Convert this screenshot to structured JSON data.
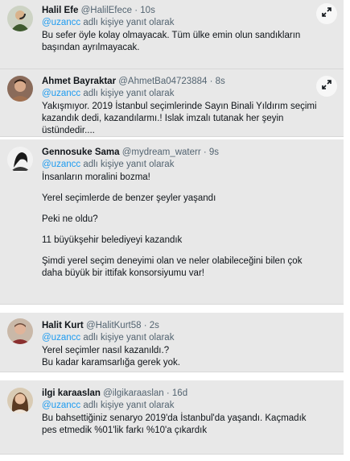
{
  "tweets": [
    {
      "name": "Halil Efe",
      "handle": "@HalilEfece",
      "time": "· 10s",
      "reply_mention": "@uzancc",
      "reply_suffix": " adlı kişiye yanıt olarak",
      "paragraphs": [
        "Bu sefer öyle kolay olmayacak. Tüm ülke emin olun sandıkların başından ayrılmayacak."
      ],
      "avatar_icon": "profile-photo",
      "expand_icon": "expand-arrows-icon"
    },
    {
      "name": "Ahmet Bayraktar",
      "handle": "@AhmetBa04723884",
      "time": "· 8s",
      "reply_mention": "@uzancc",
      "reply_suffix": " adlı kişiye yanıt olarak",
      "paragraphs": [
        "Yakışmıyor. 2019 İstanbul seçimlerinde Sayın Binali Yıldırım seçimi kazandık dedi, kazandılarmı.! Islak imzalı tutanak her şeyin üstündedir...."
      ],
      "avatar_icon": "profile-photo",
      "expand_icon": "expand-arrows-icon"
    },
    {
      "name": "Gennosuke Sama",
      "handle": "@mydream_waterr",
      "time": "· 9s",
      "reply_mention": "@uzancc",
      "reply_suffix": " adlı kişiye yanıt olarak",
      "paragraphs": [
        "İnsanların moralini bozma!",
        "Yerel seçimlerde de benzer şeyler yaşandı",
        "Peki ne oldu?",
        "11 büyükşehir belediyeyi kazandık",
        "Şimdi yerel seçim deneyimi olan ve neler olabileceğini bilen çok daha büyük bir ittifak konsorsiyumu var!"
      ],
      "avatar_icon": "profile-photo",
      "expand_icon": "expand-arrows-icon"
    },
    {
      "name": "Halit Kurt",
      "handle": "@HalitKurt58",
      "time": "· 2s",
      "reply_mention": "@uzancc",
      "reply_suffix": " adlı kişiye yanıt olarak",
      "paragraphs": [
        "Yerel seçimler nasıl kazanıldı.?\nBu kadar karamsarlığa gerek yok."
      ],
      "avatar_icon": "profile-photo",
      "expand_icon": "expand-arrows-icon"
    },
    {
      "name": "ilgi karaaslan",
      "handle": "@ilgikaraaslan",
      "time": "· 16d",
      "reply_mention": "@uzancc",
      "reply_suffix": " adlı kişiye yanıt olarak",
      "paragraphs": [
        "Bu bahsettiğiniz senaryo 2019'da İstanbul'da yaşandı. Kaçmadık pes etmedik %01'lik farkı %10'a çıkardık"
      ],
      "avatar_icon": "profile-photo",
      "expand_icon": "expand-arrows-icon"
    }
  ]
}
